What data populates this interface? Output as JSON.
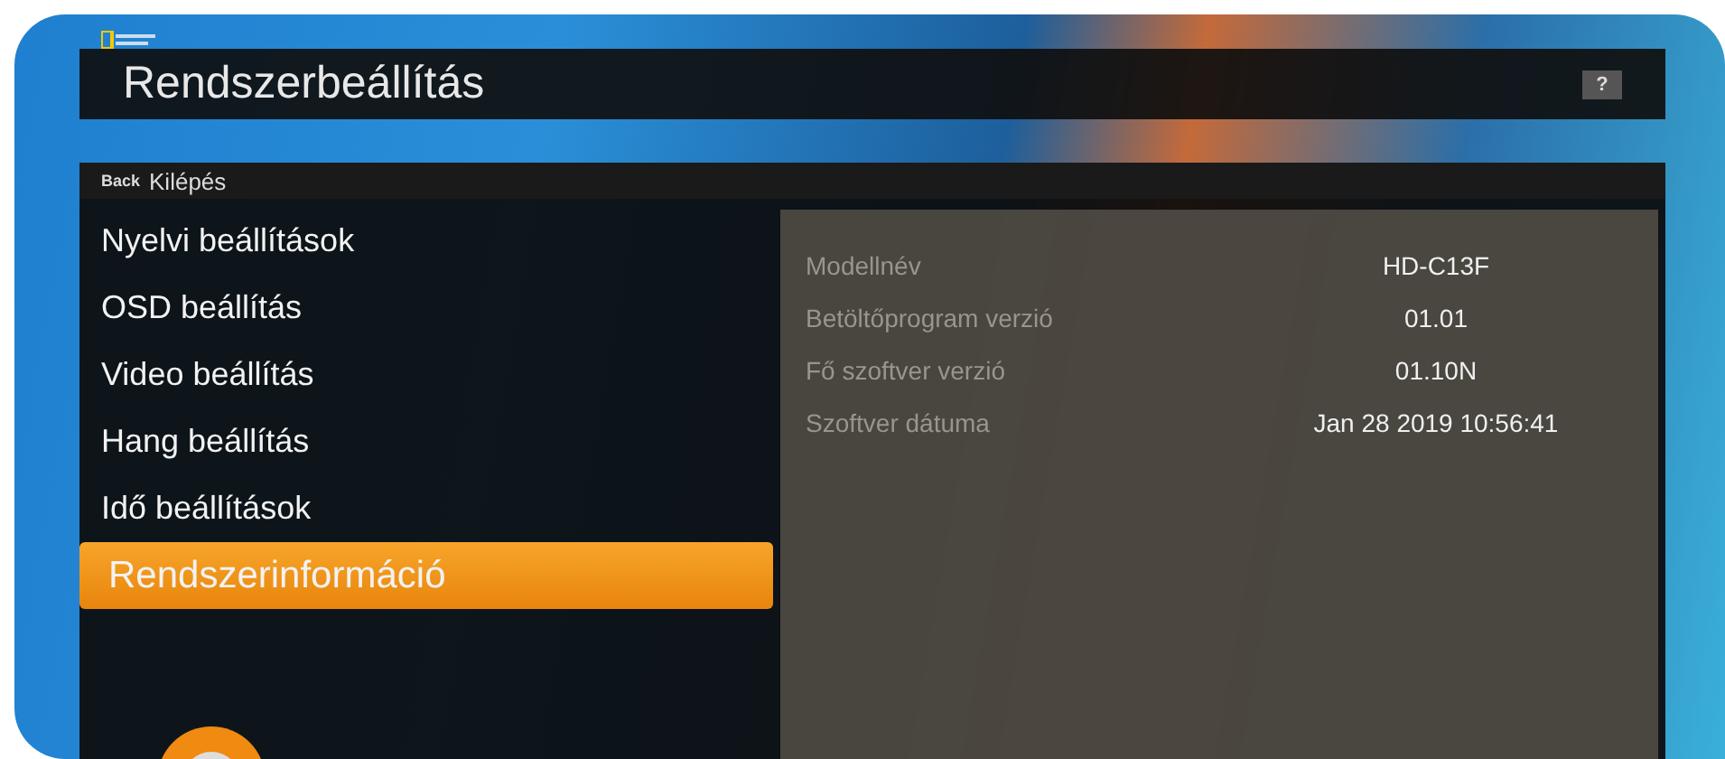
{
  "title": "Rendszerbeállítás",
  "help_button": "?",
  "back": {
    "key": "Back",
    "label": "Kilépés"
  },
  "menu": [
    {
      "label": "Nyelvi beállítások",
      "selected": false
    },
    {
      "label": "OSD beállítás",
      "selected": false
    },
    {
      "label": "Video beállítás",
      "selected": false
    },
    {
      "label": "Hang beállítás",
      "selected": false
    },
    {
      "label": "Idő beállítások",
      "selected": false
    },
    {
      "label": "Rendszerinformáció",
      "selected": true
    }
  ],
  "info": [
    {
      "label": "Modellnév",
      "value": "HD-C13F"
    },
    {
      "label": "Betöltőprogram verzió",
      "value": "01.01"
    },
    {
      "label": "Fő szoftver verzió",
      "value": "01.10N"
    },
    {
      "label": "Szoftver dátuma",
      "value": "Jan 28 2019 10:56:41"
    }
  ]
}
